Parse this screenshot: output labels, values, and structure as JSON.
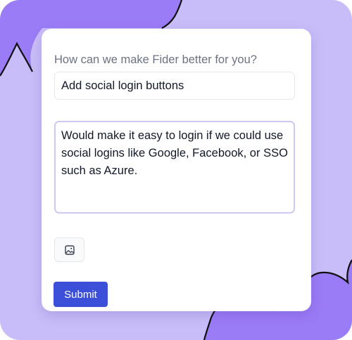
{
  "form": {
    "question_label": "How can we make Fider better for you?",
    "title_value": "Add social login buttons",
    "description_value": "Would make it easy to login if we could use social logins like Google, Facebook, or SSO such as Azure.",
    "attach_icon": "image-icon",
    "submit_label": "Submit"
  },
  "colors": {
    "background": "#c9bdf9",
    "blob": "#9b7cf7",
    "accent": "#3b4fd8",
    "textarea_border": "#cfc8f3"
  }
}
